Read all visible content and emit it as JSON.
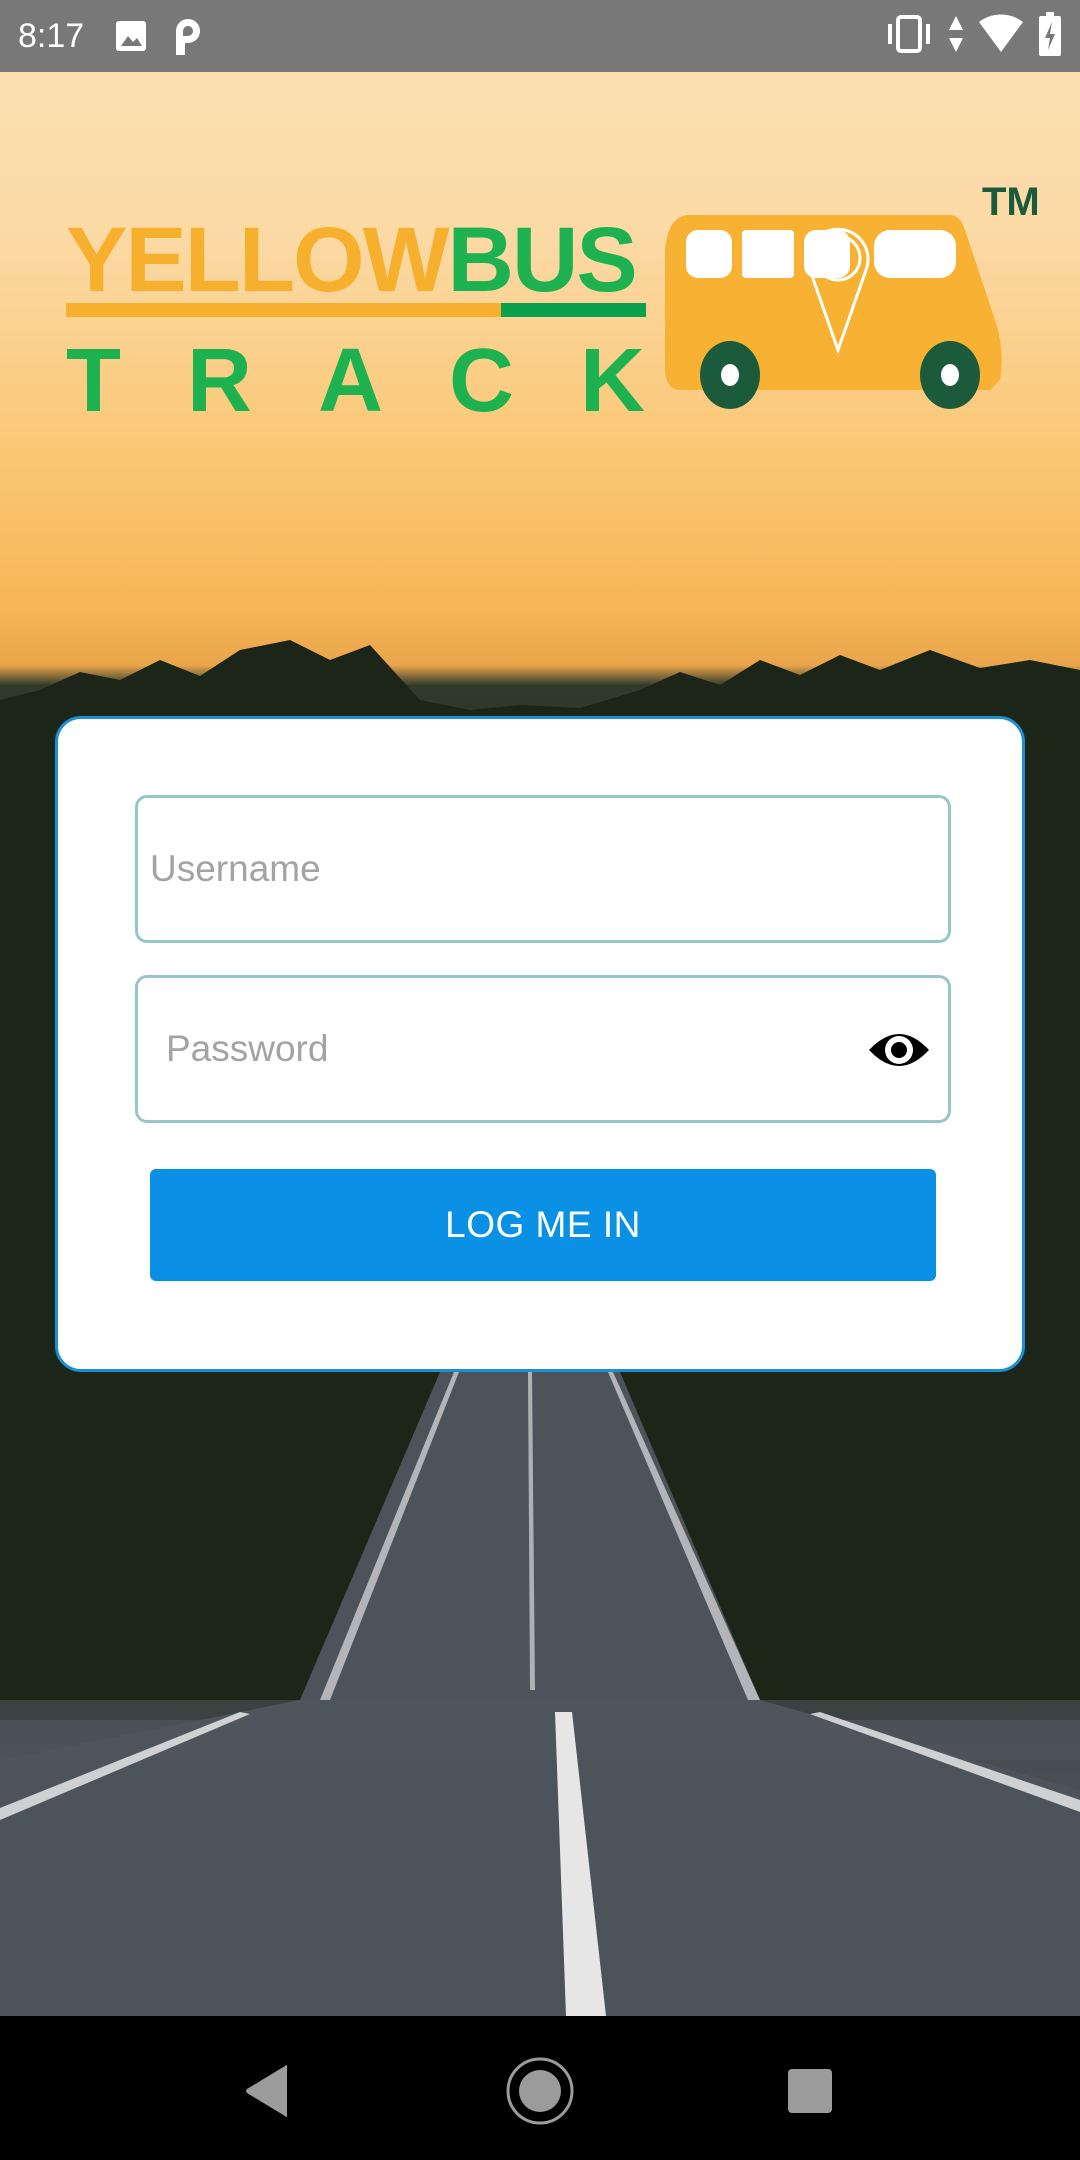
{
  "status_bar": {
    "time": "8:17",
    "left_icons": [
      "image-icon",
      "parking-p-icon"
    ],
    "right_icons": [
      "vibrate-icon",
      "data-arrows-icon",
      "wifi-icon",
      "battery-charging-icon"
    ]
  },
  "logo": {
    "word_yellow": "YELLOW",
    "word_green": "BUS",
    "word_track": "TRACK",
    "trademark": "TM",
    "colors": {
      "yellow": "#f7b02d",
      "green": "#1eb14f",
      "dark_green": "#1c5a3c"
    }
  },
  "login": {
    "username_placeholder": "Username",
    "username_value": "",
    "password_placeholder": "Password",
    "password_value": "",
    "toggle_visibility_icon": "eye-icon",
    "submit_label": "LOG ME IN",
    "colors": {
      "button": "#0a91e6",
      "card_border": "#1a8fd6",
      "field_border": "#97c6c8"
    }
  },
  "nav_bar": {
    "buttons": [
      "back-icon",
      "home-icon",
      "recents-icon"
    ]
  }
}
